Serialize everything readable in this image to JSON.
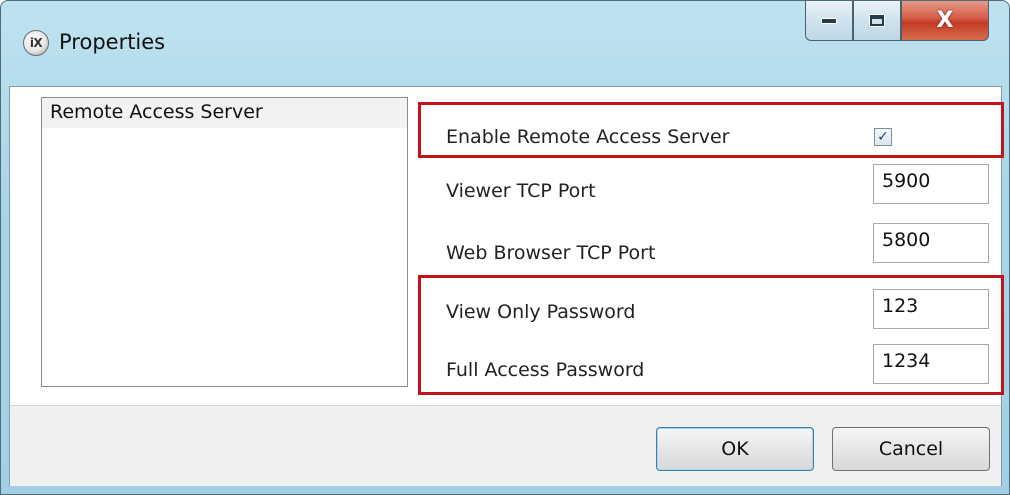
{
  "window": {
    "title": "Properties",
    "icon_text": "iX",
    "icons": {
      "app": "ix-app-icon",
      "minimize": "minimize-icon",
      "maximize": "maximize-icon",
      "close": "close-icon"
    },
    "close_glyph": "X"
  },
  "sidebar": {
    "items": [
      {
        "label": "Remote Access Server",
        "selected": true
      }
    ]
  },
  "settings": {
    "enable_label": "Enable Remote Access Server",
    "enable_checked": true,
    "check_glyph": "✓",
    "viewer_port": {
      "label": "Viewer TCP Port",
      "value": "5900"
    },
    "web_port": {
      "label": "Web Browser TCP Port",
      "value": "5800"
    },
    "view_password": {
      "label": "View Only Password",
      "value": "123"
    },
    "full_password": {
      "label": "Full Access Password",
      "value": "1234"
    }
  },
  "buttons": {
    "ok": "OK",
    "cancel": "Cancel"
  },
  "colors": {
    "highlight": "#c2151b",
    "title_bar": "#a9d5e8",
    "close_button": "#c33b24"
  }
}
